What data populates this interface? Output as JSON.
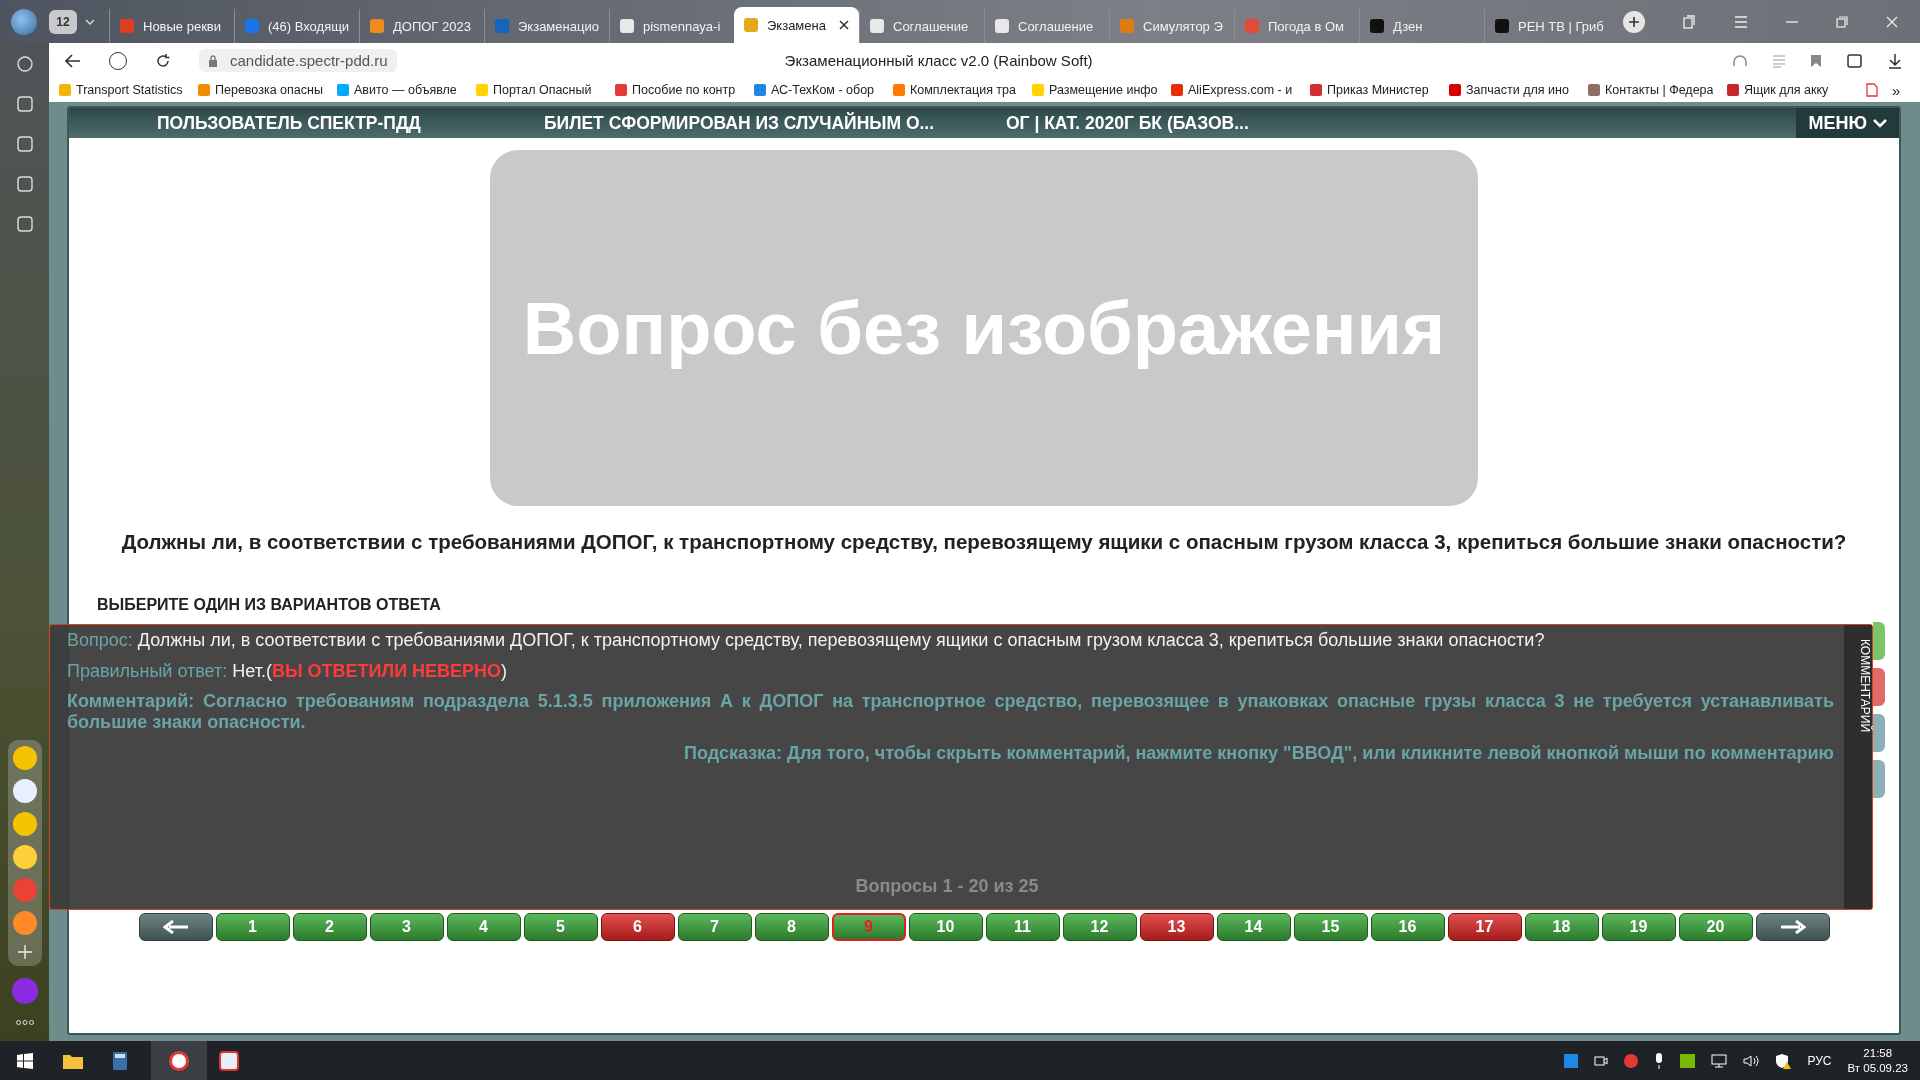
{
  "browser": {
    "tab_count": "12",
    "tabs": [
      {
        "label": "Новые рекви",
        "selected": false,
        "color": "#e03c1e"
      },
      {
        "label": "(46) Входящи",
        "selected": false,
        "color": "#1a73e8"
      },
      {
        "label": "ДОПОГ 2023",
        "selected": false,
        "color": "#f08a1c"
      },
      {
        "label": "Экзаменацио",
        "selected": false,
        "color": "#1565c0"
      },
      {
        "label": "pismennaya-i",
        "selected": false,
        "color": "#e8e8e8"
      },
      {
        "label": "Экзамена",
        "selected": true,
        "color": "#e6a817"
      },
      {
        "label": "Соглашение",
        "selected": false,
        "color": "#e8e8e8"
      },
      {
        "label": "Соглашение",
        "selected": false,
        "color": "#e8e8e8"
      },
      {
        "label": "Симулятор Э",
        "selected": false,
        "color": "#e07b10"
      },
      {
        "label": "Погода в Ом",
        "selected": false,
        "color": "#e5493a"
      },
      {
        "label": "Дзен",
        "selected": false,
        "color": "#111111"
      },
      {
        "label": "РЕН ТВ | Гриб",
        "selected": false,
        "color": "#111111"
      }
    ],
    "address": "candidate.spectr-pdd.ru",
    "page_title": "Экзаменационный класс v2.0 (Rainbow Soft)",
    "bookmarks": [
      {
        "label": "Transport Statistics",
        "color": "#f2b705"
      },
      {
        "label": "Перевозка опасны",
        "color": "#f28c00"
      },
      {
        "label": "Авито — объявле",
        "color": "#00aaff"
      },
      {
        "label": "Портал Опасный",
        "color": "#ffd200"
      },
      {
        "label": "Пособие по контр",
        "color": "#e53935"
      },
      {
        "label": "АС-ТехКом - обор",
        "color": "#1e88e5"
      },
      {
        "label": "Комплектация тра",
        "color": "#ff7a00"
      },
      {
        "label": "Размещение инфо",
        "color": "#ffd200"
      },
      {
        "label": "AliExpress.com - и",
        "color": "#e62e04"
      },
      {
        "label": "Приказ Министер",
        "color": "#d32f2f"
      },
      {
        "label": "Запчасти для ино",
        "color": "#d50000"
      },
      {
        "label": "Контакты | Федера",
        "color": "#8d6e63"
      },
      {
        "label": "Ящик для акку",
        "color": "#c62828"
      }
    ],
    "more": "»"
  },
  "header": {
    "items": [
      "ПОЛЬЗОВАТЕЛЬ СПЕКТР-ПДД",
      "БИЛЕТ СФОРМИРОВАН ИЗ СЛУЧАЙНЫМ О...",
      "ОГ | КАТ. 2020Г БК (БАЗОВ..."
    ],
    "menu": "МЕНЮ"
  },
  "image_placeholder": "Вопрос без изображения",
  "question": "Должны ли, в соответствии с требованиями ДОПОГ, к транспортному средству, перевозящему ящики с опасным грузом класса 3, крепиться большие знаки опасности?",
  "prompt": "ВЫБЕРИТЕ ОДИН ИЗ ВАРИАНТОВ ОТВЕТА",
  "answers": [
    {
      "kind": "correct"
    },
    {
      "kind": "wrong"
    },
    {
      "kind": "neutral"
    },
    {
      "kind": "neutral"
    }
  ],
  "comment": {
    "question_label": "Вопрос:",
    "question": "Должны ли, в соответствии с требованиями ДОПОГ, к транспортному средству, перевозящему ящики с опасным грузом класса 3, крепиться большие знаки опасности?",
    "answer_label": "Правильный ответ:",
    "answer": "Нет.(",
    "verdict": "ВЫ ОТВЕТИЛИ НЕВЕРНО",
    "answer_end": ")",
    "comment": "Комментарий: Согласно требованиям подраздела 5.1.3.5 приложения А к ДОПОГ на транспортное средство, перевозящее в упаковках опасные грузы класса 3 не требуется устанавливать большие знаки опасности.",
    "hint": "Подсказка: Для того, чтобы скрыть комментарий, нажмите кнопку \"ВВОД\", или кликните левой кнопкой мыши по комментарию",
    "side_tab": "КОММЕНТАРИЙ",
    "pager": "Вопросы 1 - 20 из 25"
  },
  "nav": [
    {
      "label": "1",
      "correct": true,
      "selected": false
    },
    {
      "label": "2",
      "correct": true,
      "selected": false
    },
    {
      "label": "3",
      "correct": true,
      "selected": false
    },
    {
      "label": "4",
      "correct": true,
      "selected": false
    },
    {
      "label": "5",
      "correct": true,
      "selected": false
    },
    {
      "label": "6",
      "correct": false,
      "selected": false
    },
    {
      "label": "7",
      "correct": true,
      "selected": false
    },
    {
      "label": "8",
      "correct": true,
      "selected": false
    },
    {
      "label": "9",
      "correct": true,
      "selected": true
    },
    {
      "label": "10",
      "correct": true,
      "selected": false
    },
    {
      "label": "11",
      "correct": true,
      "selected": false
    },
    {
      "label": "12",
      "correct": true,
      "selected": false
    },
    {
      "label": "13",
      "correct": false,
      "selected": false
    },
    {
      "label": "14",
      "correct": true,
      "selected": false
    },
    {
      "label": "15",
      "correct": true,
      "selected": false
    },
    {
      "label": "16",
      "correct": true,
      "selected": false
    },
    {
      "label": "17",
      "correct": false,
      "selected": false
    },
    {
      "label": "18",
      "correct": true,
      "selected": false
    },
    {
      "label": "19",
      "correct": true,
      "selected": false
    },
    {
      "label": "20",
      "correct": true,
      "selected": false
    }
  ],
  "taskbar": {
    "language": "РУС",
    "time": "21:58",
    "date": "Вт 05.09.23"
  }
}
